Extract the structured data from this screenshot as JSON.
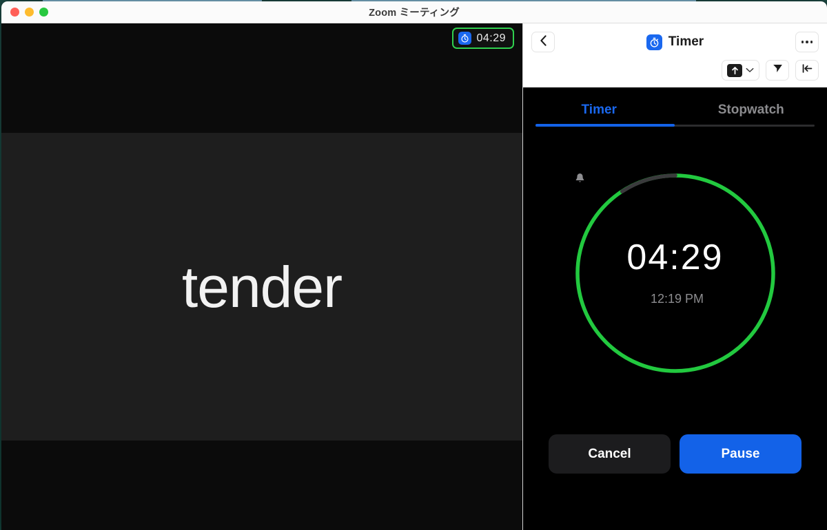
{
  "window": {
    "title": "Zoom ミーティング",
    "traffic_lights": [
      {
        "name": "close",
        "color": "#ff5f57"
      },
      {
        "name": "minimize",
        "color": "#febc2e"
      },
      {
        "name": "zoom",
        "color": "#28c840"
      }
    ]
  },
  "stage": {
    "participant_name": "tender",
    "timer_pill": {
      "icon": "stopwatch-icon",
      "time": "04:29",
      "border_color": "#2fd04e",
      "icon_bg": "#1a68ef"
    }
  },
  "panel": {
    "header": {
      "back_icon": "chevron-left-icon",
      "app_icon": "stopwatch-icon",
      "title": "Timer",
      "more_icon": "ellipsis-icon"
    },
    "toolbar": {
      "share_icon": "share-up-arrow-icon",
      "share_chevron_icon": "chevron-down-icon",
      "send_icon": "paper-plane-icon",
      "collapse_icon": "collapse-left-icon"
    },
    "tabs": [
      {
        "label": "Timer",
        "active": true
      },
      {
        "label": "Stopwatch",
        "active": false
      }
    ],
    "timer": {
      "remaining": "04:29",
      "alarm_icon": "bell-icon",
      "alarm_time": "12:19 PM",
      "progress_color": "#22c93f",
      "track_color": "#3a3a3c",
      "progress_percent": 84
    },
    "actions": {
      "cancel_label": "Cancel",
      "pause_label": "Pause",
      "pause_color": "#1362e8",
      "cancel_color": "#1c1c1e"
    }
  }
}
